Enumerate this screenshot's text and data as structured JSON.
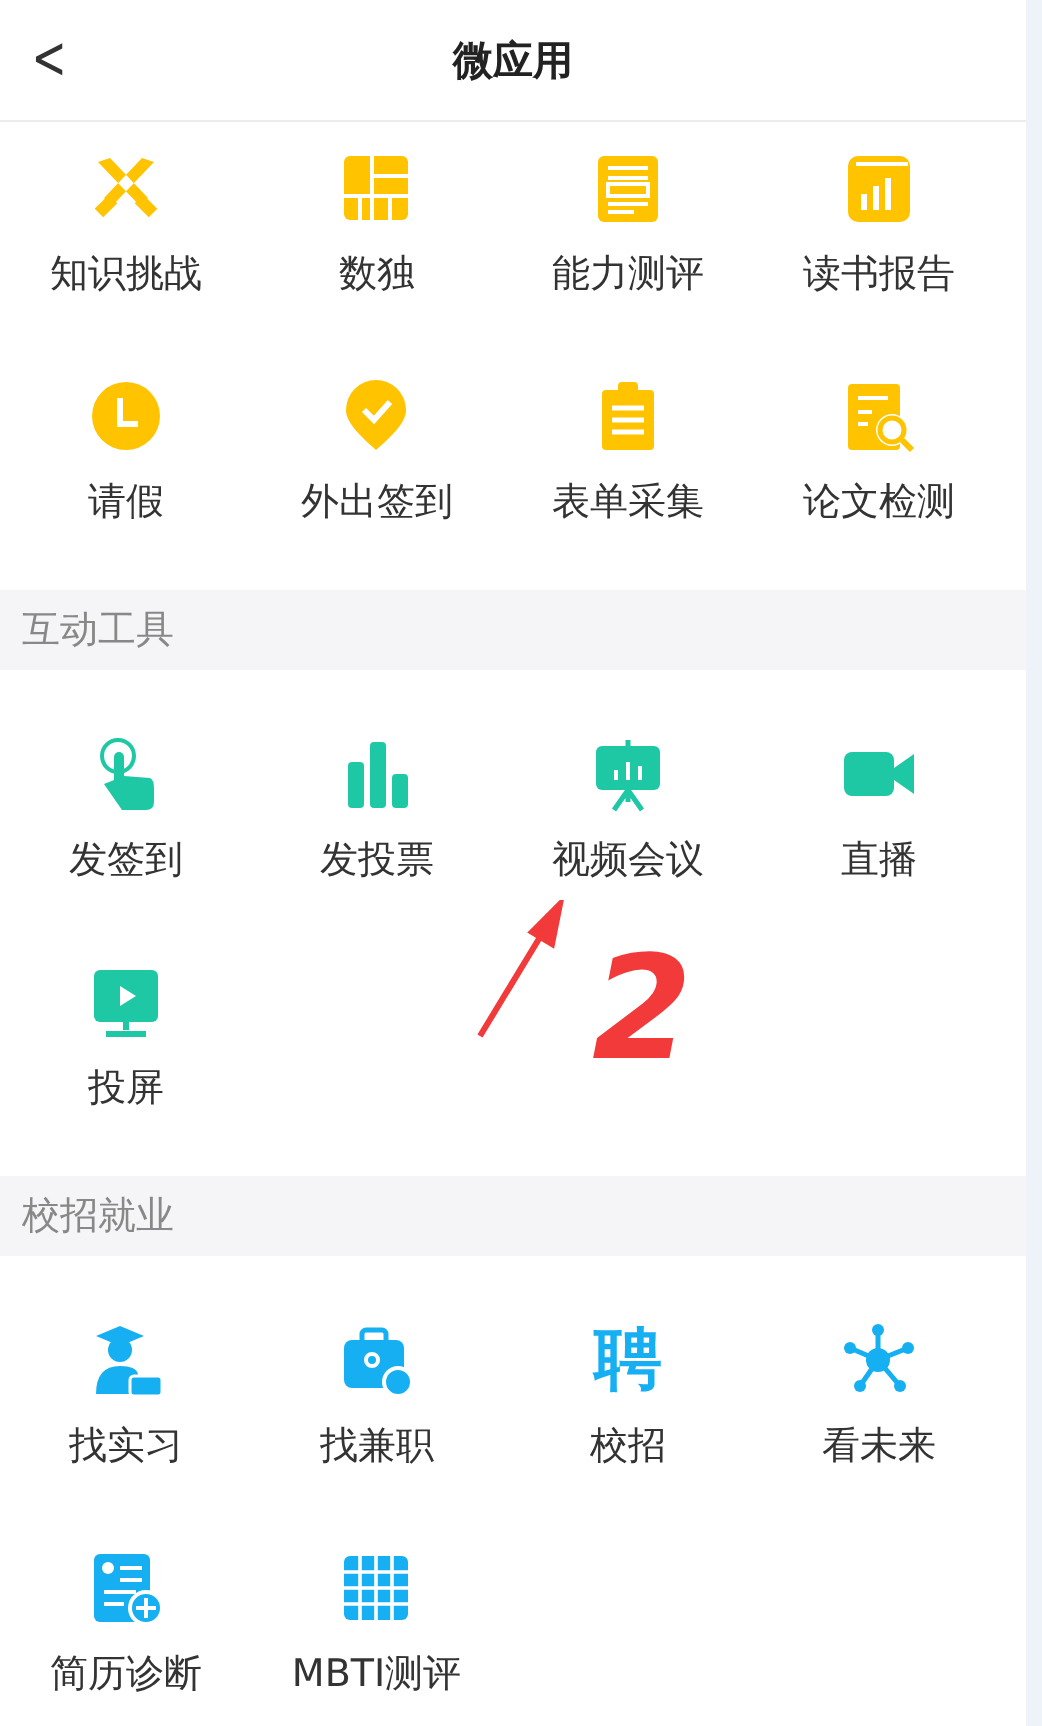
{
  "header": {
    "back": "<",
    "title": "微应用"
  },
  "sections": [
    {
      "items": [
        {
          "label": "知识挑战"
        },
        {
          "label": "数独"
        },
        {
          "label": "能力测评"
        },
        {
          "label": "读书报告"
        },
        {
          "label": "请假"
        },
        {
          "label": "外出签到"
        },
        {
          "label": "表单采集"
        },
        {
          "label": "论文检测"
        }
      ]
    },
    {
      "title": "互动工具",
      "items": [
        {
          "label": "发签到"
        },
        {
          "label": "发投票"
        },
        {
          "label": "视频会议"
        },
        {
          "label": "直播"
        },
        {
          "label": "投屏"
        }
      ]
    },
    {
      "title": "校招就业",
      "items": [
        {
          "label": "找实习"
        },
        {
          "label": "找兼职"
        },
        {
          "label": "校招",
          "glyph": "聘"
        },
        {
          "label": "看未来"
        },
        {
          "label": "简历诊断"
        },
        {
          "label": "MBTI测评"
        }
      ]
    }
  ],
  "annotation": {
    "text": "2"
  }
}
